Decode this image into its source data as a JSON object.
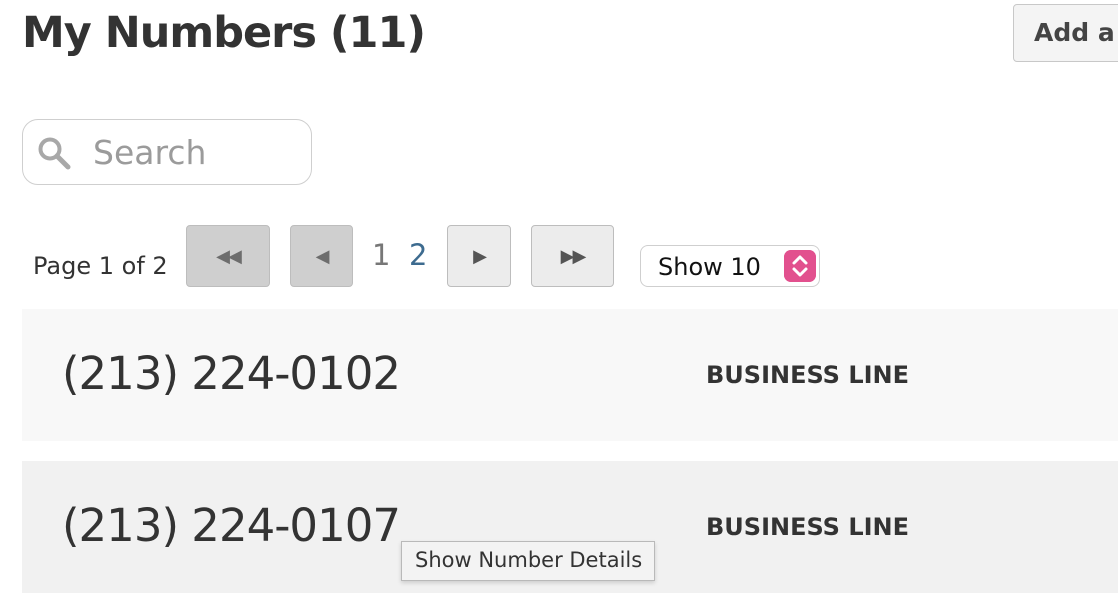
{
  "header": {
    "title": "My Numbers (11)",
    "add_button_label": "Add a U"
  },
  "search": {
    "placeholder": "Search",
    "value": ""
  },
  "pager": {
    "label": "Page 1 of 2",
    "first_symbol": "◀◀",
    "prev_symbol": "◀",
    "next_symbol": "▶",
    "last_symbol": "▶▶",
    "pages": [
      "1",
      "2"
    ],
    "show_select": "Show 10"
  },
  "numbers": [
    {
      "number": "(213) 224-0102",
      "type": "BUSINESS LINE"
    },
    {
      "number": "(213) 224-0107",
      "type": "BUSINESS LINE"
    }
  ],
  "tooltip": "Show Number Details",
  "colors": {
    "accent": "#e2508e",
    "link": "#3d6b8f"
  }
}
